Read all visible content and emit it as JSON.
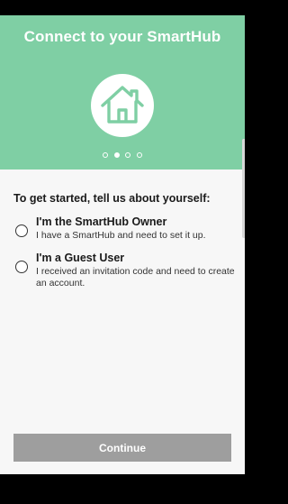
{
  "header": {
    "title": "Connect to your SmartHub"
  },
  "hero": {
    "icon": "house-icon",
    "pager": {
      "count": 4,
      "active_index": 1
    }
  },
  "prompt": "To get started, tell us about yourself:",
  "options": [
    {
      "title": "I'm the SmartHub Owner",
      "description": "I have a SmartHub and need to set it up."
    },
    {
      "title": "I'm a Guest User",
      "description": "I received an invitation code and need to create an account."
    }
  ],
  "continue_label": "Continue",
  "colors": {
    "hero_bg": "#7fcfa4",
    "button_disabled": "#9e9e9e"
  }
}
